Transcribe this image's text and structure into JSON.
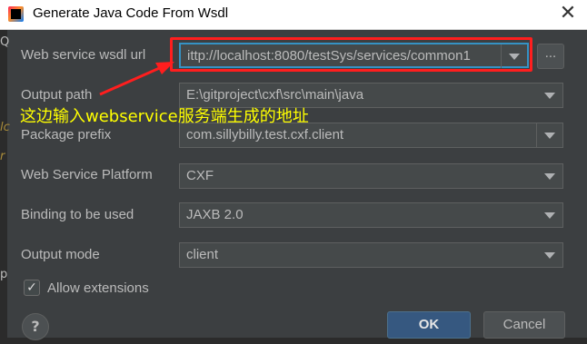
{
  "dialog": {
    "title": "Generate Java Code From Wsdl",
    "close_symbol": "✕"
  },
  "fields": {
    "wsdl_url": {
      "label": "Web service wsdl url",
      "value": "ittp://localhost:8080/testSys/services/common1"
    },
    "output_path": {
      "label": "Output path",
      "value": "E:\\gitproject\\cxf\\src\\main\\java"
    },
    "package_prefix": {
      "label": "Package prefix",
      "value": "com.sillybilly.test.cxf.client"
    },
    "platform": {
      "label": "Web Service Platform",
      "value": "CXF"
    },
    "binding": {
      "label": "Binding to be used",
      "value": "JAXB 2.0"
    },
    "output_mode": {
      "label": "Output mode",
      "value": "client"
    }
  },
  "browse_label": "...",
  "allow_extensions": {
    "label": "Allow extensions",
    "checked": true,
    "check_symbol": "✓"
  },
  "annotation_text": "这边输入webservice服务端生成的地址",
  "buttons": {
    "help": "?",
    "ok": "OK",
    "cancel": "Cancel"
  },
  "background_glyphs": [
    "Q",
    "lc",
    "r",
    "p"
  ],
  "colors": {
    "annotation": "#ffff00",
    "highlight_box": "#ff1e1e",
    "focus": "#3592c4",
    "ok_button": "#365880"
  }
}
